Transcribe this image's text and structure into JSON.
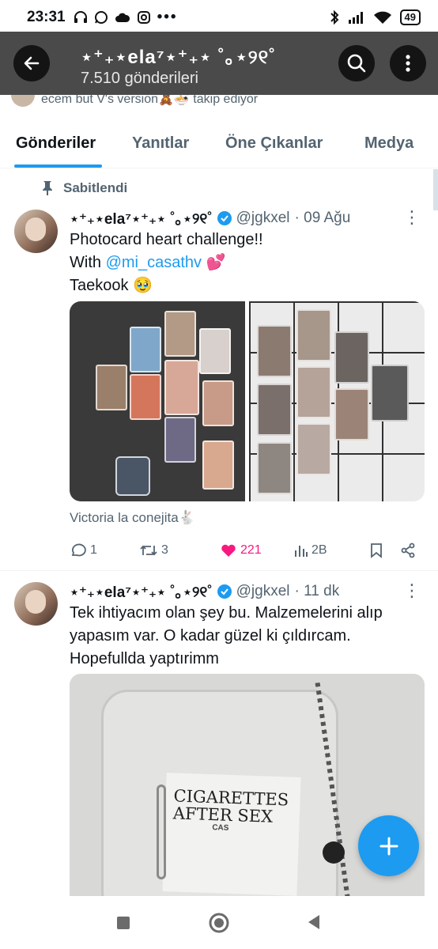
{
  "status_bar": {
    "time": "23:31",
    "battery": "49"
  },
  "header": {
    "display_name": "⋆⁺₊⋆ela⁷⋆⁺₊⋆ ˚｡⋆୨୧˚",
    "post_count": "7.510 gönderileri"
  },
  "peek": {
    "text": "ecem but V's version🧸🍜 takip ediyor"
  },
  "tabs": [
    {
      "label": "Gönderiler",
      "active": true
    },
    {
      "label": "Yanıtlar",
      "active": false
    },
    {
      "label": "Öne Çıkanlar",
      "active": false
    },
    {
      "label": "Medya",
      "active": false
    }
  ],
  "posts": [
    {
      "pinned_label": "Sabitlendi",
      "name": "⋆⁺₊⋆ela⁷⋆⁺₊⋆ ˚｡⋆୨୧˚",
      "handle": "@jgkxel",
      "time": "· 09 Ağu",
      "text_line1": "Photocard heart challenge!!",
      "text_line2_prefix": "With ",
      "mention": "@mi_casathv",
      "text_line2_suffix": " 💕",
      "text_line3": "Taekook 🥹",
      "attribution": "Victoria la conejita🐇",
      "replies": "1",
      "reposts": "3",
      "likes": "221",
      "views": "2B"
    },
    {
      "name": "⋆⁺₊⋆ela⁷⋆⁺₊⋆ ˚｡⋆୨୧˚",
      "handle": "@jgkxel",
      "time": "· 11 dk",
      "text_line1": "Tek ihtiyacım olan şey bu. Malzemelerini alıp",
      "text_line2": "yapasım var. O kadar güzel ki çıldırcam.",
      "text_line3": "Hopefullda yaptırimm",
      "image_text1": "CIGARETTES",
      "image_text2": "AFTER SEX",
      "image_text3": "CAS"
    }
  ],
  "colors": {
    "accent": "#1d9bf0",
    "like": "#f91880",
    "header_bg": "#4a4a4a",
    "muted": "#536471"
  },
  "icons": [
    "back-arrow-icon",
    "search-icon",
    "more-vertical-icon",
    "pin-icon",
    "verified-badge-icon",
    "reply-icon",
    "repost-icon",
    "heart-icon",
    "views-icon",
    "bookmark-icon",
    "share-icon",
    "plus-icon"
  ]
}
